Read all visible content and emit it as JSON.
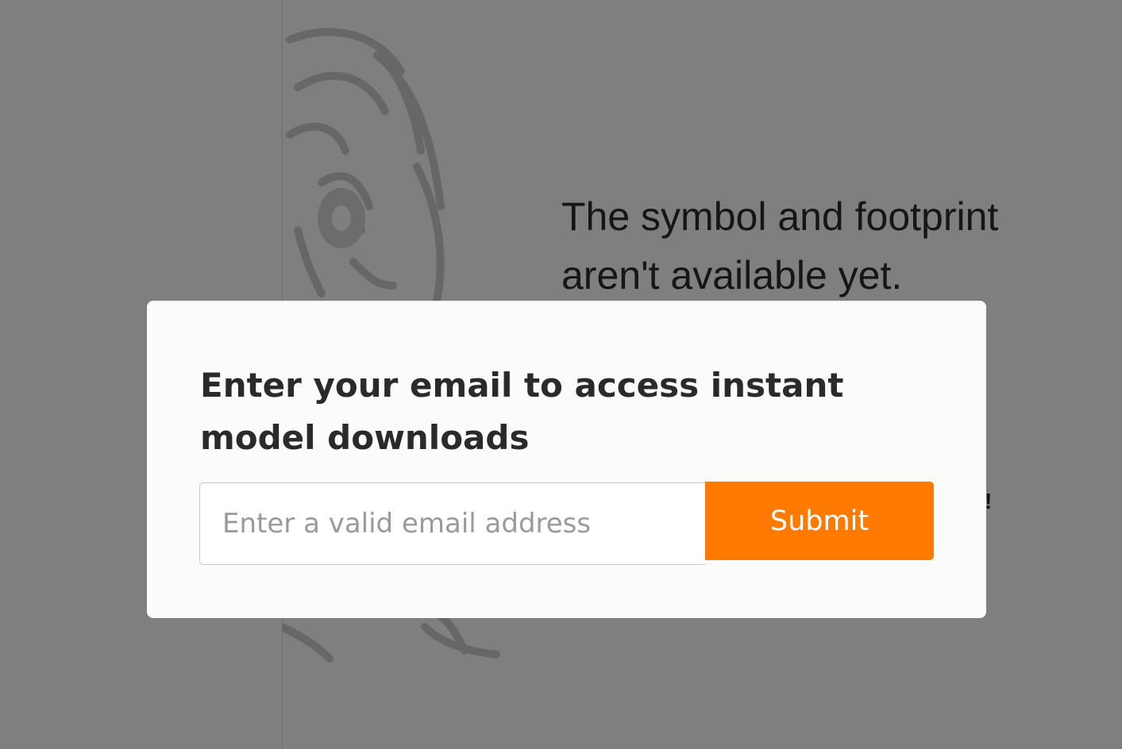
{
  "background": {
    "message": "The symbol and footprint aren't available yet.",
    "partial_text": "!"
  },
  "modal": {
    "title": "Enter your email to access instant model downloads",
    "email_placeholder": "Enter a valid email address",
    "submit_label": "Submit"
  },
  "colors": {
    "accent": "#ff7a00",
    "overlay": "rgba(0,0,0,0.5)",
    "modal_background": "#fbfbfb"
  },
  "icons": {
    "background_illustration": "tiger-illustration"
  }
}
